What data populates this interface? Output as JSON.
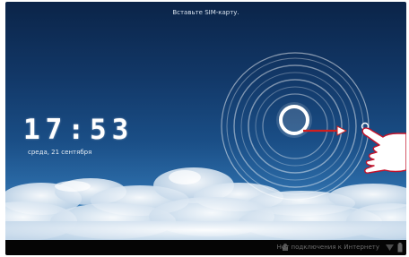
{
  "lockscreen": {
    "status_message": "Вставьте SIM-карту.",
    "time": "17:53",
    "date": "среда, 21 сентября"
  },
  "system_bar": {
    "network_status": "Нет подключения к Интернету",
    "icons": [
      "network-settings-icon",
      "wifi-signal-icon",
      "battery-icon"
    ]
  },
  "annotations": {
    "arrow_color": "#d11f1f",
    "hand_outline_color": "#c4122a"
  }
}
